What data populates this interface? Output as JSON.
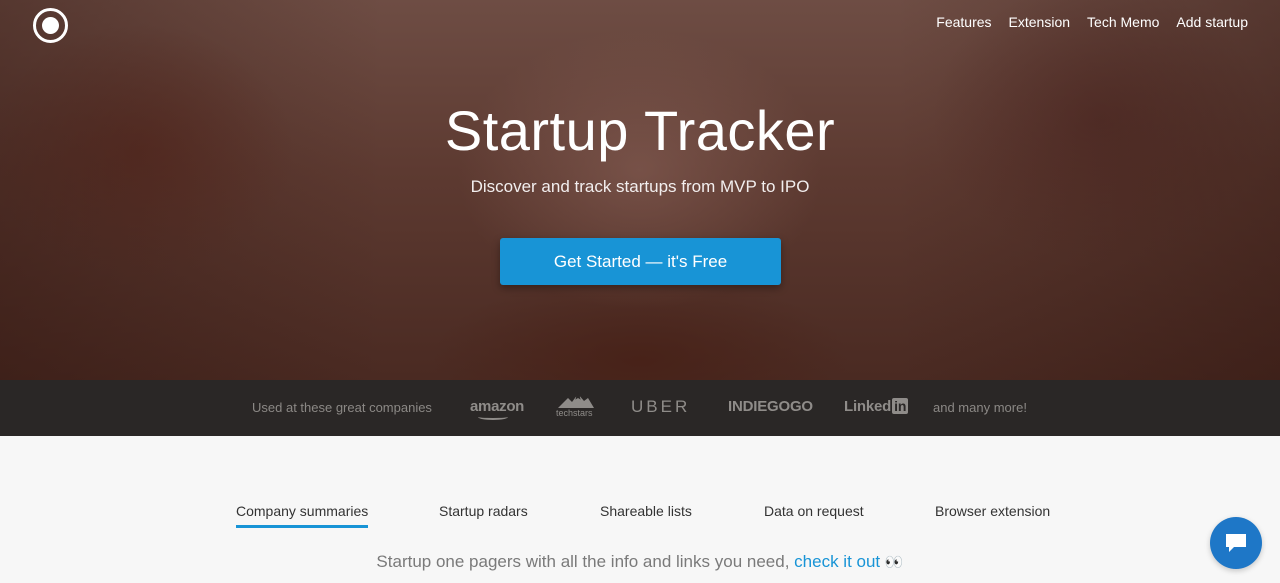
{
  "nav": {
    "links": [
      "Features",
      "Extension",
      "Tech Memo",
      "Add startup"
    ]
  },
  "hero": {
    "title": "Startup Tracker",
    "subtitle": "Discover and track startups from MVP to IPO",
    "cta_label": "Get Started — it's Free"
  },
  "logos": {
    "intro": "Used at these great companies",
    "brands": [
      "amazon",
      "techstars",
      "UBER",
      "INDIEGOGO",
      "Linked",
      "in"
    ],
    "outro": "and many more!"
  },
  "features": {
    "tabs": [
      "Company summaries",
      "Startup radars",
      "Shareable lists",
      "Data on request",
      "Browser extension"
    ],
    "active_tab": "Company summaries",
    "description": "Startup one pagers with all the info and links you need,",
    "link_text": "check it out",
    "emoji": "👀"
  },
  "colors": {
    "accent": "#1894d6",
    "chat": "#1e77c7",
    "logos_bar": "#2a2726"
  },
  "icons": [
    "logo-ring-icon",
    "chat-icon",
    "techstars-mountain-icon"
  ]
}
